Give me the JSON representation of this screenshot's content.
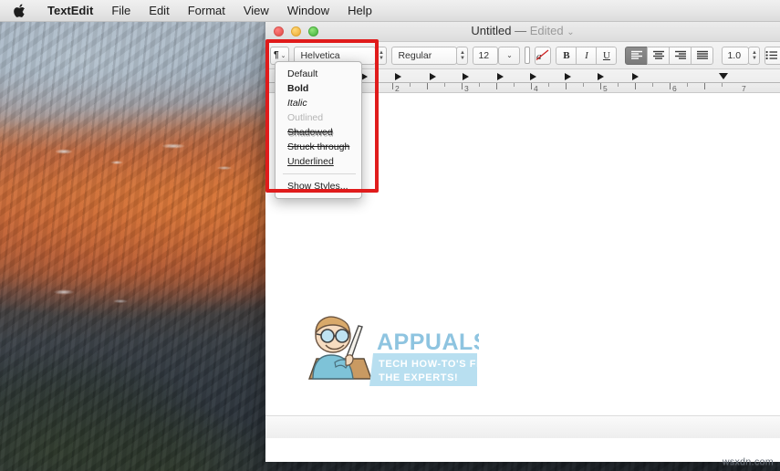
{
  "menubar": {
    "apple_icon": "apple-logo-icon",
    "items": [
      {
        "label": "TextEdit",
        "bold": true
      },
      {
        "label": "File",
        "bold": false
      },
      {
        "label": "Edit",
        "bold": false
      },
      {
        "label": "Format",
        "bold": false
      },
      {
        "label": "View",
        "bold": false
      },
      {
        "label": "Window",
        "bold": false
      },
      {
        "label": "Help",
        "bold": false
      }
    ]
  },
  "window": {
    "title": {
      "document": "Untitled",
      "dash": "—",
      "state": "Edited",
      "chevron": "⌄"
    },
    "traffic_lights": {
      "close": "close-button",
      "minimize": "minimize-button",
      "maximize": "maximize-button"
    }
  },
  "toolbar": {
    "style_button": {
      "glyph": "¶",
      "chevron": "⌄"
    },
    "font_family": "Helvetica",
    "font_style": "Regular",
    "font_size": "12",
    "size_chevron": "⌄",
    "text_color": "#000000",
    "color_clear_icon": "clear-formatting-icon",
    "bold_label": "B",
    "italic_label": "I",
    "underline_label": "U",
    "align_left": "align-left",
    "align_center": "align-center",
    "align_right": "align-right",
    "align_justify": "align-justify",
    "align_active": "align-left",
    "line_spacing": "1.0",
    "spacing_stepper": "⇅",
    "list_icon": "list-icon",
    "list_chevron": "⌄"
  },
  "ruler": {
    "numbers": [
      "2",
      "3",
      "4",
      "5",
      "6",
      "7"
    ],
    "tab_markers": 10,
    "indent_marker_color": "#e8392e"
  },
  "style_menu": {
    "items": [
      {
        "label": "Default",
        "style": "normal"
      },
      {
        "label": "Bold",
        "style": "bold"
      },
      {
        "label": "Italic",
        "style": "italic"
      },
      {
        "label": "Outlined",
        "style": "disabled"
      },
      {
        "label": "Shadowed",
        "style": "shadowed"
      },
      {
        "label": "Struck through",
        "style": "struck"
      },
      {
        "label": "Underlined",
        "style": "underlined"
      }
    ],
    "footer_item": "Show Styles..."
  },
  "logo": {
    "wordmark": "APPUALS",
    "tagline_line1": "TECH HOW-TO'S FROM",
    "tagline_line2": "THE EXPERTS!",
    "wordmark_color": "#8ec4e0",
    "banner_color": "#b8dff0",
    "tagline_color": "#ffffff"
  },
  "annotation": {
    "color": "#e01b1b",
    "shape": "rectangle-highlight"
  },
  "watermark": {
    "text": "wsxdn.com"
  }
}
